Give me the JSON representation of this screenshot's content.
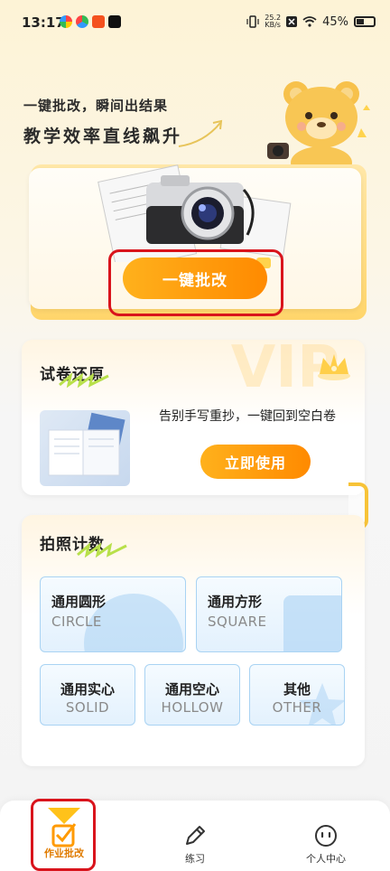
{
  "status_bar": {
    "time": "13:17",
    "net_speed_value": "25.2",
    "net_speed_unit": "KB/s",
    "battery": "45%"
  },
  "hero": {
    "subtitle": "一键批改，瞬间出结果",
    "title": "教学效率直线飙升"
  },
  "scan": {
    "button_label": "一键批改"
  },
  "restore": {
    "title": "试卷还原",
    "description": "告别手写重抄，一键回到空白卷",
    "button_label": "立即使用",
    "watermark": "VIP"
  },
  "count": {
    "title": "拍照计数",
    "tiles": [
      {
        "cn": "通用圆形",
        "en": "CIRCLE"
      },
      {
        "cn": "通用方形",
        "en": "SQUARE"
      },
      {
        "cn": "通用实心",
        "en": "SOLID"
      },
      {
        "cn": "通用空心",
        "en": "HOLLOW"
      },
      {
        "cn": "其他",
        "en": "OTHER"
      }
    ]
  },
  "nav": {
    "items": [
      {
        "label": "作业批改",
        "icon": "homework-check-icon",
        "active": true
      },
      {
        "label": "练习",
        "icon": "pencil-icon",
        "active": false
      },
      {
        "label": "个人中心",
        "icon": "face-icon",
        "active": false
      }
    ]
  },
  "colors": {
    "accent": "#ff9500",
    "highlight_border": "#d9141c",
    "tile_border": "#a9d3f3"
  }
}
